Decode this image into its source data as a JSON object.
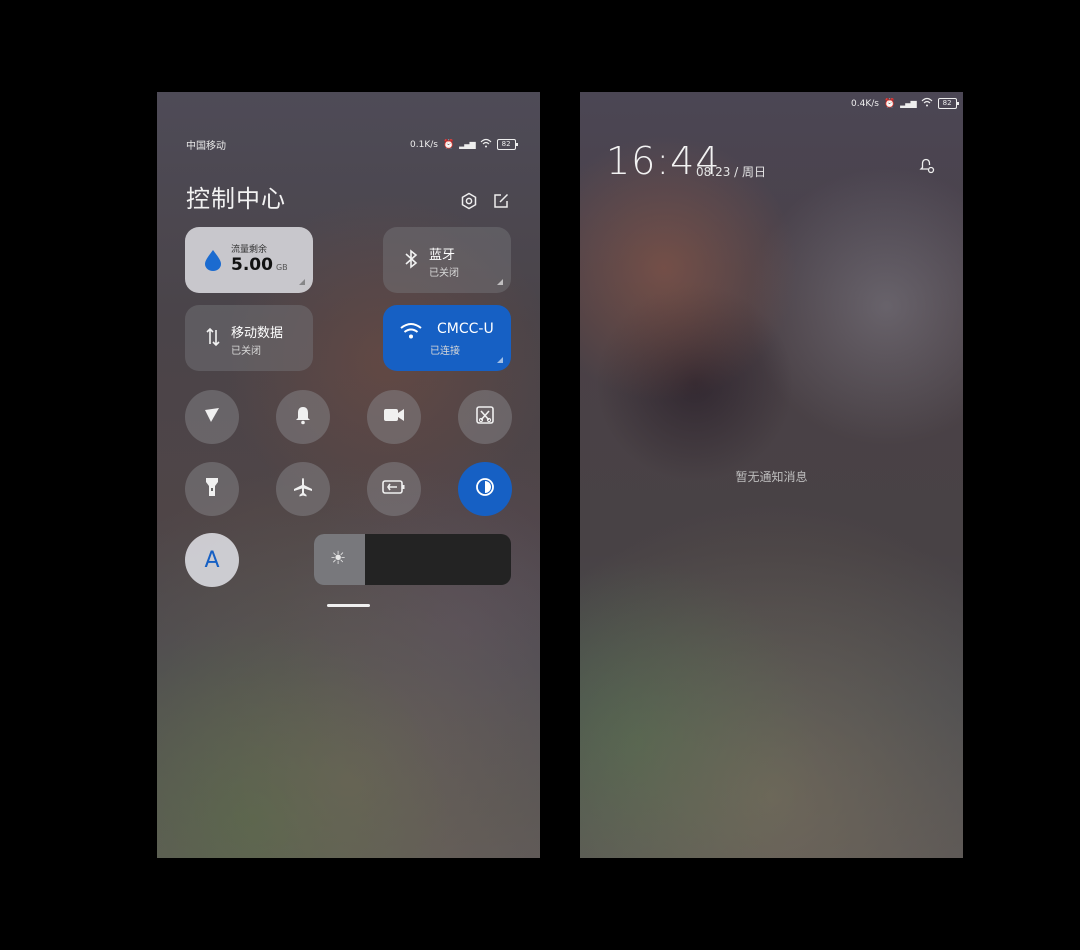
{
  "control_center": {
    "carrier": "中国移动",
    "net_speed": "0.1K/s",
    "battery": "82",
    "title": "控制中心",
    "header_icons": [
      "settings-icon",
      "edit-icon"
    ],
    "tiles": {
      "data": {
        "label": "流量剩余",
        "value": "5.00",
        "unit": "GB"
      },
      "bluetooth": {
        "label": "蓝牙",
        "status": "已关闭"
      },
      "mobile_data": {
        "label": "移动数据",
        "status": "已关闭"
      },
      "wifi": {
        "label": "CMCC-U",
        "status": "已连接"
      }
    },
    "toggles_row1": [
      "location-icon",
      "bell-icon",
      "video-icon",
      "screenshot-icon"
    ],
    "toggles_row2": [
      "flashlight-icon",
      "airplane-icon",
      "battery-saver-icon",
      "dark-mode-icon"
    ],
    "auto_brightness_label": "A",
    "brightness_level": 0.26
  },
  "lock_screen": {
    "net_speed": "0.4K/s",
    "battery": "82",
    "time": "16:44",
    "date": "08.23 / 周日",
    "empty_message": "暂无通知消息"
  },
  "colors": {
    "accent": "#1660c4",
    "background": "#000000"
  }
}
